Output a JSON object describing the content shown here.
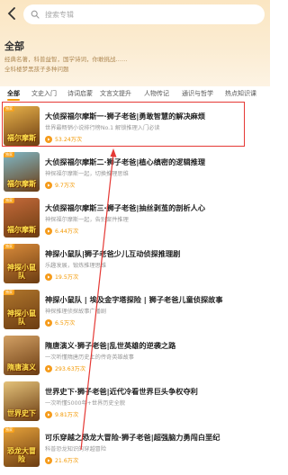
{
  "search": {
    "placeholder": "搜索专辑"
  },
  "category": {
    "title": "全部",
    "desc_lines": [
      "经典名著，科普益智，国学诗词，你敢挑战……",
      "全科楼梦黑孩子多种问题"
    ]
  },
  "tabs": [
    {
      "label": "全部",
      "active": true
    },
    {
      "label": "文史入门",
      "active": false
    },
    {
      "label": "诗词启蒙",
      "active": false
    },
    {
      "label": "文言文提升",
      "active": false
    },
    {
      "label": "人物传记",
      "active": false
    },
    {
      "label": "通识与哲学",
      "active": false
    },
    {
      "label": "热点知识课",
      "active": false
    }
  ],
  "items": [
    {
      "title": "大侦探福尔摩斯一·狮子老爸|勇敢智慧的解决麻烦",
      "desc": "世界最畅销小说排行榜No.1 解锁推理入门必读",
      "plays": "53.24万次",
      "cover_text": "福尔摩斯",
      "cover_bg": "#e8b24a",
      "badge": "独家"
    },
    {
      "title": "大侦探福尔摩斯二·狮子老爸|植心缜密的逻辑推理",
      "desc": "神探福尔摩斯一起，切换推理思维",
      "plays": "9.7万次",
      "cover_text": "福尔摩斯",
      "cover_bg": "#7fb8c8",
      "badge": "独家"
    },
    {
      "title": "大侦探福尔摩斯三·狮子老爸|抽丝剥茧的剖析人心",
      "desc": "神探福尔摩斯一起，告别案件推理",
      "plays": "6.44万次",
      "cover_text": "福尔摩斯",
      "cover_bg": "#c56a3a",
      "badge": "独家"
    },
    {
      "title": "神探小鼠队|狮子老爸少儿互动侦探推理剧",
      "desc": "乐趣发展，锻炼推理思维",
      "plays": "19.5万次",
      "cover_text": "神探小鼠队",
      "cover_bg": "#d98b3a",
      "badge": "独家"
    },
    {
      "title": "神探小鼠队 | 埃及金字塔探险 | 狮子老爸儿童侦探故事",
      "desc": "神探推理侦探故事广播剧",
      "plays": "6.5万次",
      "cover_text": "神探小鼠队",
      "cover_bg": "#b0762c",
      "badge": "独家"
    },
    {
      "title": "隋唐演义·狮子老爸|乱世英雄的逆袭之路",
      "desc": "一次听懂隋唐历史上的传奇英雄故事",
      "plays": "293.63万次",
      "cover_text": "隋唐演义",
      "cover_bg": "#d2a064",
      "badge": ""
    },
    {
      "title": "世界史下·狮子老爸|近代冷看世界巨头争权夺利",
      "desc": "一次听懂5000年+世界历史全貌",
      "plays": "9.81万次",
      "cover_text": "世界史下",
      "cover_bg": "#e4c27a",
      "badge": ""
    },
    {
      "title": "可乐穿越之恐龙大冒险·狮子老爸|超强脑力勇闯白垩纪",
      "desc": "科普恐龙知识的穿越冒险",
      "plays": "21.6万次",
      "cover_text": "恐龙大冒险",
      "cover_bg": "#e6a23a",
      "badge": "独家"
    }
  ],
  "colors": {
    "accent": "#f39800",
    "highlight": "#e53935"
  },
  "icons": {
    "back": "chevron-left-icon",
    "search": "search-icon",
    "play": "play-icon"
  }
}
